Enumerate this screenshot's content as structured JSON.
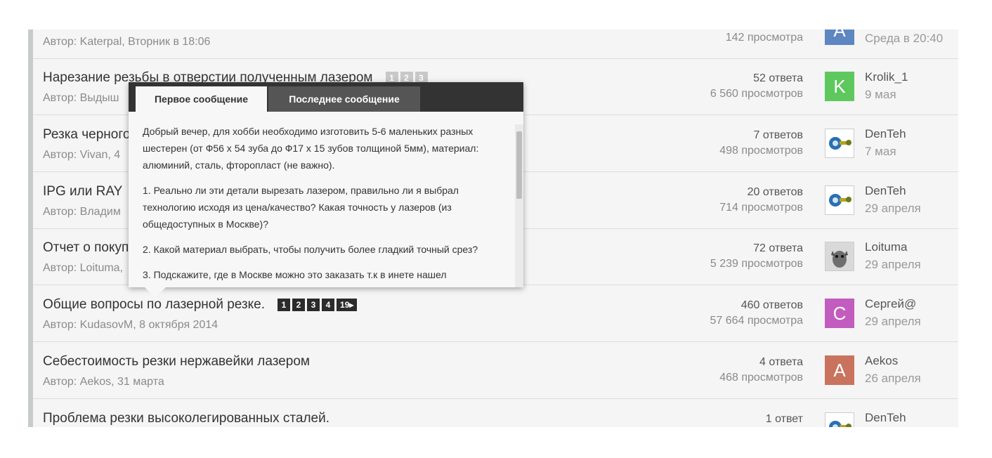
{
  "threads": [
    {
      "title": "",
      "author": "Автор: Katerpal, Вторник в 18:06",
      "pages": [],
      "replies": "",
      "views": "142 просмотра",
      "avatar_letter": "A",
      "avatar_color": "#5e86c1",
      "last_user": "",
      "last_date": "Среда в 20:40"
    },
    {
      "title": "Нарезание резьбы в отверстии полученным лазером",
      "author": "Автор: Выдыш",
      "pages": [
        "1",
        "2",
        "3"
      ],
      "pages_faded": true,
      "replies": "52 ответа",
      "views": "6 560 просмотров",
      "avatar_letter": "K",
      "avatar_color": "#5ec85e",
      "last_user": "Krolik_1",
      "last_date": "9 мая"
    },
    {
      "title": "Резка черного",
      "author": "Автор: Vivan, 4",
      "pages": [],
      "replies": "7 ответов",
      "views": "498 просмотров",
      "avatar_icon": "gear-avatar-icon",
      "last_user": "DenTeh",
      "last_date": "7 мая"
    },
    {
      "title": "IPG или RAY",
      "author": "Автор: Владим",
      "pages": [],
      "replies": "20 ответов",
      "views": "714 просмотров",
      "avatar_icon": "gear-avatar-icon",
      "last_user": "DenTeh",
      "last_date": "29 апреля"
    },
    {
      "title": "Отчет о покуп",
      "author": "Автор: Loituma,",
      "pages": [],
      "replies": "72 ответа",
      "views": "5 239 просмотров",
      "avatar_icon": "dog-avatar-icon",
      "last_user": "Loituma",
      "last_date": "29 апреля"
    },
    {
      "title": "Общие вопросы по лазерной резке.",
      "author": "Автор: KudasovM, 8 октября 2014",
      "pages": [
        "1",
        "2",
        "3",
        "4",
        "19▸"
      ],
      "replies": "460 ответов",
      "views": "57 664 просмотра",
      "avatar_letter": "C",
      "avatar_color": "#c35cbf",
      "last_user": "Сергей@",
      "last_date": "29 апреля"
    },
    {
      "title": "Себестоимость резки нержавейки лазером",
      "author": "Автор: Aekos, 31 марта",
      "pages": [],
      "replies": "4 ответа",
      "views": "468 просмотров",
      "avatar_letter": "A",
      "avatar_color": "#c9735e",
      "last_user": "Aekos",
      "last_date": "26 апреля"
    },
    {
      "title": "Проблема резки высоколегированных сталей.",
      "author": "",
      "pages": [],
      "replies": "1 ответ",
      "views": "",
      "avatar_icon": "gear-avatar-icon",
      "last_user": "DenTeh",
      "last_date": ""
    }
  ],
  "popup": {
    "tab_first": "Первое сообщение",
    "tab_last": "Последнее сообщение",
    "paragraphs": [
      "Добрый вечер, для хобби необходимо изготовить 5-6 маленьких разных шестерен (от Ф56 х 54 зуба до Ф17 х 15 зубов толщиной 5мм), материал: алюминий, сталь, фторопласт (не важно).",
      "1. Реально ли эти детали вырезать лазером, правильно ли я выбрал технологию исходя из цена/качество? Какая точность у лазеров (из общедоступных в Москве)?",
      "2. Какой материал выбрать, чтобы получить более гладкий точный срез?",
      "3. Подскажите, где в Москве можно это заказать т.к в инете нашел"
    ]
  }
}
